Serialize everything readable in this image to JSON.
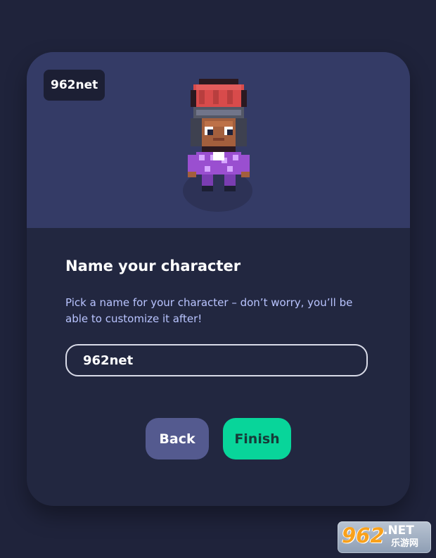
{
  "preview": {
    "name_tag": "962net"
  },
  "form": {
    "title": "Name your character",
    "description": "Pick a name for your character – don’t worry, you’ll be able to customize it after!",
    "name_value": "962net",
    "name_placeholder": ""
  },
  "actions": {
    "back_label": "Back",
    "finish_label": "Finish"
  },
  "watermark": {
    "number": "962",
    "suffix": ".NET",
    "chinese": "乐游网"
  },
  "colors": {
    "background": "#1f233b",
    "card": "#222740",
    "preview": "#343b66",
    "back_button": "#545a8f",
    "finish_button": "#08d59a",
    "accent_text": "#b9c4ff"
  },
  "icons": {
    "character": "pixel-character-icon"
  }
}
